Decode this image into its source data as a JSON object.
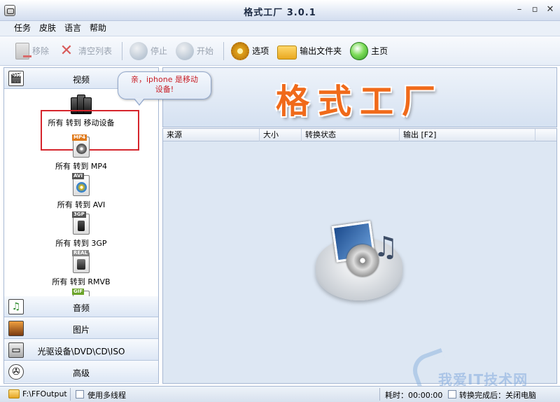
{
  "window": {
    "title": "格式工厂  3.0.1",
    "minimize": "–",
    "restore": "▫",
    "close": "✕"
  },
  "menu": [
    "任务",
    "皮肤",
    "语言",
    "帮助"
  ],
  "toolbar": {
    "remove": "移除",
    "clear_list": "清空列表",
    "stop": "停止",
    "start": "开始",
    "options": "选项",
    "output_folder": "输出文件夹",
    "home": "主页"
  },
  "sidebar": {
    "categories": [
      {
        "label": "视频",
        "icon": "video-icon"
      },
      {
        "label": "音频",
        "icon": "music-icon"
      },
      {
        "label": "图片",
        "icon": "picture-icon"
      },
      {
        "label": "光驱设备\\DVD\\CD\\ISO",
        "icon": "disc-drive-icon"
      },
      {
        "label": "高级",
        "icon": "film-reel-icon"
      }
    ],
    "video_items": [
      {
        "label": "所有 转到 移动设备",
        "badge": ""
      },
      {
        "label": "所有 转到 MP4",
        "badge": "MP4"
      },
      {
        "label": "所有 转到 AVI",
        "badge": "AVI"
      },
      {
        "label": "所有 转到 3GP",
        "badge": "3GP"
      },
      {
        "label": "所有 转到 RMVB",
        "badge": "REAL"
      },
      {
        "label": "",
        "badge": "GIF"
      }
    ]
  },
  "tooltip": {
    "line1": "亲，iphone 是移动",
    "line2": "设备!"
  },
  "banner": {
    "title": "格式工厂"
  },
  "file_list": {
    "columns": [
      "来源",
      "大小",
      "转换状态",
      "输出 [F2]"
    ]
  },
  "status": {
    "output_path": "F:\\FFOutput",
    "multithread_label": "使用多线程",
    "elapsed_label": "耗时：00:00:00",
    "after_convert_label": "转换完成后：关闭电脑"
  },
  "watermark": {
    "text": "我爱IT技术网"
  },
  "colors": {
    "banner_text": "#f06a1a",
    "highlight": "#d6262d",
    "tooltip_text": "#c81d25",
    "panel": "#dde7f3"
  }
}
